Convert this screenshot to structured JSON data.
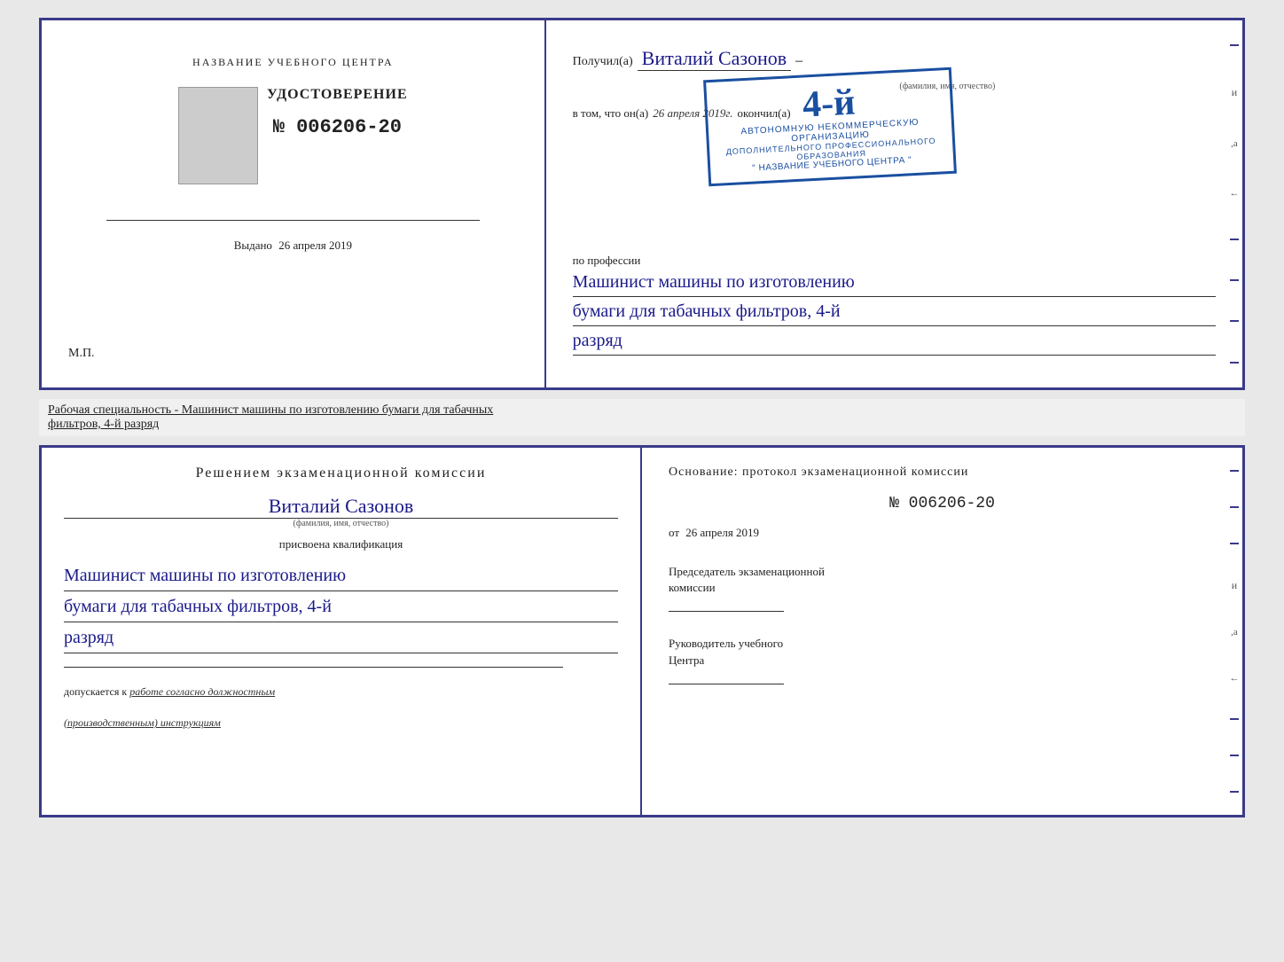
{
  "page": {
    "background_color": "#e8e8e8"
  },
  "top_certificate": {
    "left_panel": {
      "org_name_label": "НАЗВАНИЕ УЧЕБНОГО ЦЕНТРА",
      "udostoverenie_label": "УДОСТОВЕРЕНИЕ",
      "cert_number": "№ 006206-20",
      "issued_label": "Выдано",
      "issued_date": "26 апреля 2019",
      "mp_label": "М.П."
    },
    "right_panel": {
      "recipient_prefix": "Получил(а)",
      "recipient_name": "Виталий Сазонов",
      "name_hint": "(фамилия, имя, отчество)",
      "dash": "–",
      "vtom_label": "в том, что он(а)",
      "vtom_date": "26 апреля 2019г.",
      "okoncil_label": "окончил(а)",
      "stamp": {
        "rank_number": "4-й",
        "rank_suffix_label": "",
        "org_line1": "АВТОНОМНУЮ НЕКОММЕРЧЕСКУЮ ОРГАНИЗАЦИЮ",
        "org_line2": "ДОПОЛНИТЕЛЬНОГО ПРОФЕССИОНАЛЬНОГО ОБРАЗОВАНИЯ",
        "org_line3": "\" НАЗВАНИЕ УЧЕБНОГО ЦЕНТРА \""
      },
      "po_professii_label": "по профессии",
      "profession_line1": "Машинист машины по изготовлению",
      "profession_line2": "бумаги для табачных фильтров, 4-й",
      "profession_line3": "разряд"
    }
  },
  "specialty_banner": {
    "label_prefix": "Рабочая специальность - Машинист машины по изготовлению бумаги для табачных",
    "label_suffix": "фильтров, 4-й разряд"
  },
  "bottom_certificate": {
    "left_panel": {
      "resheniem_title": "Решением  экзаменационной  комиссии",
      "person_name": "Виталий Сазонов",
      "fio_hint": "(фамилия, имя, отчество)",
      "prisvoyena_label": "присвоена квалификация",
      "qualification_line1": "Машинист машины по изготовлению",
      "qualification_line2": "бумаги для табачных фильтров, 4-й",
      "qualification_line3": "разряд",
      "dopuskaetsya_label": "допускается к",
      "dopuskaetsya_value": "работе согласно должностным",
      "dopuskaetsya_value2": "(производственным) инструкциям"
    },
    "right_panel": {
      "osnovanie_label": "Основание:  протокол  экзаменационной  комиссии",
      "protocol_number": "№  006206-20",
      "ot_label": "от",
      "protocol_date": "26 апреля 2019",
      "predsedatel_label": "Председатель экзаменационной\nкомиссии",
      "rukovoditel_label": "Руководитель учебного\nЦентра"
    }
  }
}
